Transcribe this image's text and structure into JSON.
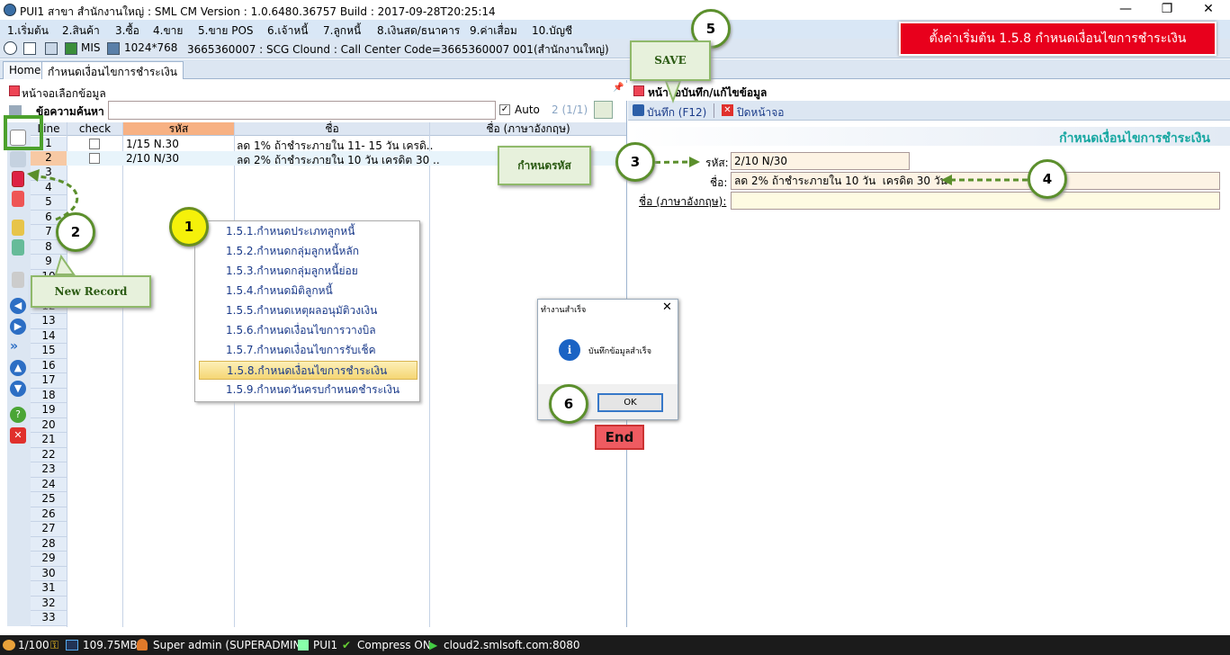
{
  "window": {
    "title": "PUI1 สาขา สำนักงานใหญ่ : SML CM Version : 1.0.6480.36757  Build : 2017-09-28T20:25:14",
    "minimize": "—",
    "restore": "❐",
    "close": "✕"
  },
  "menu": [
    "1.เริ่มต้น",
    "2.สินค้า",
    "3.ซื้อ",
    "4.ขาย",
    "5.ขาย POS",
    "6.เจ้าหนี้",
    "7.ลูกหนี้",
    "8.เงินสด/ธนาคาร",
    "9.ค่าเสื่อม",
    "10.บัญชี"
  ],
  "toolbar": {
    "mis": "MIS",
    "resolution": "1024*768",
    "connection": "3665360007 : SCG Clound : Call Center Code=3665360007 001(สำนักงานใหญ่)"
  },
  "banner": "ตั้งค่าเริ่มต้น 1.5.8 กำหนดเงื่อนไขการชำระเงิน",
  "tabs": [
    "Home",
    "กำหนดเงื่อนไขการชำระเงิน"
  ],
  "left_pane": {
    "title": "หน้าจอเลือกข้อมูล",
    "search_label": "ข้อความค้นหา",
    "search_value": "",
    "auto_label": "Auto",
    "page_info": "2 (1/1)",
    "columns": [
      "Line",
      "check",
      "รหัส",
      "ชื่อ",
      "ชื่อ (ภาษาอังกฤษ)"
    ],
    "rows": [
      {
        "line": "1",
        "code": "1/15  N.30",
        "name": "ลด 1% ถ้าชำระภายใน 11- 15 วัน  เครดิ..",
        "name_en": ""
      },
      {
        "line": "2",
        "code": "2/10 N/30",
        "name": "ลด 2% ถ้าชำระภายใน 10 วัน  เครดิต 30 ..",
        "name_en": ""
      }
    ],
    "line_numbers": [
      "3",
      "4",
      "5",
      "6",
      "7",
      "8",
      "9",
      "10",
      "11",
      "12",
      "13",
      "14",
      "15",
      "16",
      "17",
      "18",
      "19",
      "20",
      "21",
      "22",
      "23",
      "24",
      "25",
      "26",
      "27",
      "28",
      "29",
      "30",
      "31",
      "32",
      "33"
    ]
  },
  "right_pane": {
    "title": "หน้าจอบันทึก/แก้ไขข้อมูล",
    "save_label": "บันทึก (F12)",
    "close_label": "ปิดหน้าจอ",
    "form_heading": "กำหนดเงื่อนไขการชำระเงิน",
    "code_label": "รหัส:",
    "code_value": "2/10 N/30",
    "name_label": "ชื่อ:",
    "name_value": "ลด 2% ถ้าชำระภายใน 10 วัน  เครดิต 30 วัน",
    "name_en_label": "ชื่อ (ภาษาอังกฤษ):",
    "name_en_value": ""
  },
  "popup_menu": {
    "items": [
      "1.5.1.กำหนดประเภทลูกหนี้",
      "1.5.2.กำหนดกลุ่มลูกหนี้หลัก",
      "1.5.3.กำหนดกลุ่มลูกหนี้ย่อย",
      "1.5.4.กำหนดมิติลูกหนี้",
      "1.5.5.กำหนดเหตุผลอนุมัติวงเงิน",
      "1.5.6.กำหนดเงื่อนไขการวางบิล",
      "1.5.7.กำหนดเงื่อนไขการรับเช็ค",
      "1.5.8.กำหนดเงื่อนไขการชำระเงิน",
      "1.5.9.กำหนดวันครบกำหนดชำระเงิน"
    ],
    "selected_index": 7
  },
  "dialog": {
    "title": "ทำงานสำเร็จ",
    "message": "บันทึกข้อมูลสำเร็จ",
    "ok_label": "OK",
    "close": "✕"
  },
  "annotations": {
    "step1": "1",
    "step2": "2",
    "step3": "3",
    "step4": "4",
    "step5": "5",
    "step6": "6",
    "new_record": "New Record",
    "save": "SAVE",
    "set_code": "กำหนดรหัส",
    "end": "End"
  },
  "statusbar": {
    "page": "1/100",
    "memory": "109.75MB",
    "user": "Super admin (SUPERADMIN)",
    "branch": "PUI1",
    "compress": "Compress ON",
    "server": "cloud2.smlsoft.com:8080"
  },
  "colors": {
    "banner": "#e8001c",
    "annotation_green": "#5b8f2c",
    "code_column_header": "#f7b183",
    "selected_row": "#f7c9a4"
  }
}
